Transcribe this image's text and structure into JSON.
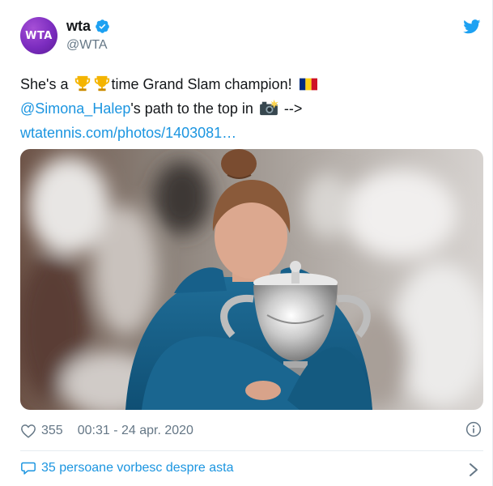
{
  "account": {
    "display_name": "wta",
    "handle": "@WTA",
    "avatar_text": "WTA"
  },
  "tweet": {
    "line1_before": "She's a ",
    "line1_after": "time Grand Slam champion!",
    "mention": "@Simona_Halep",
    "line2_after": "'s path to the top in",
    "line2_arrow": " -->",
    "link": "wtatennis.com/photos/1403081…"
  },
  "footer": {
    "likes": "355",
    "timestamp": "00:31 - 24 apr. 2020",
    "conversation": "35 persoane vorbesc despre asta"
  },
  "icons": {
    "verified": "verified-badge-icon",
    "twitter": "twitter-bird-icon",
    "heart": "heart-icon",
    "info": "info-icon",
    "bubble": "speech-bubble-icon",
    "chevron": "chevron-right-icon"
  },
  "colors": {
    "accent": "#1b95e0",
    "muted": "#657786",
    "text": "#14171a",
    "avatar": "#7b2cbf"
  }
}
